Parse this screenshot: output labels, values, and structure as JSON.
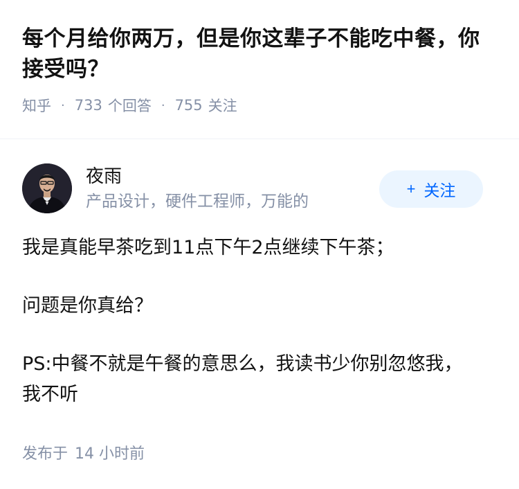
{
  "question": {
    "title": "每个月给你两万，但是你这辈子不能吃中餐，你接受吗？",
    "site": "知乎",
    "answer_count": "733",
    "answer_label": "个回答",
    "follow_count": "755",
    "follow_label": "关注",
    "separator": "·"
  },
  "answer": {
    "author": {
      "name": "夜雨",
      "description": "产品设计，硬件工程师，万能的",
      "avatar_icon": "avatar-photo"
    },
    "follow_button": {
      "plus": "+",
      "label": "关注"
    },
    "paragraphs": [
      "我是真能早茶吃到11点下午2点继续下午茶；",
      "问题是你真给？",
      "PS:中餐不就是午餐的意思么，我读书少你别忽悠我，我不听"
    ],
    "published_label": "发布于",
    "published_time": "14 小时前"
  },
  "colors": {
    "text": "#121212",
    "meta": "#8590a6",
    "accent": "#0066ff",
    "button_bg": "#ebf5ff"
  }
}
